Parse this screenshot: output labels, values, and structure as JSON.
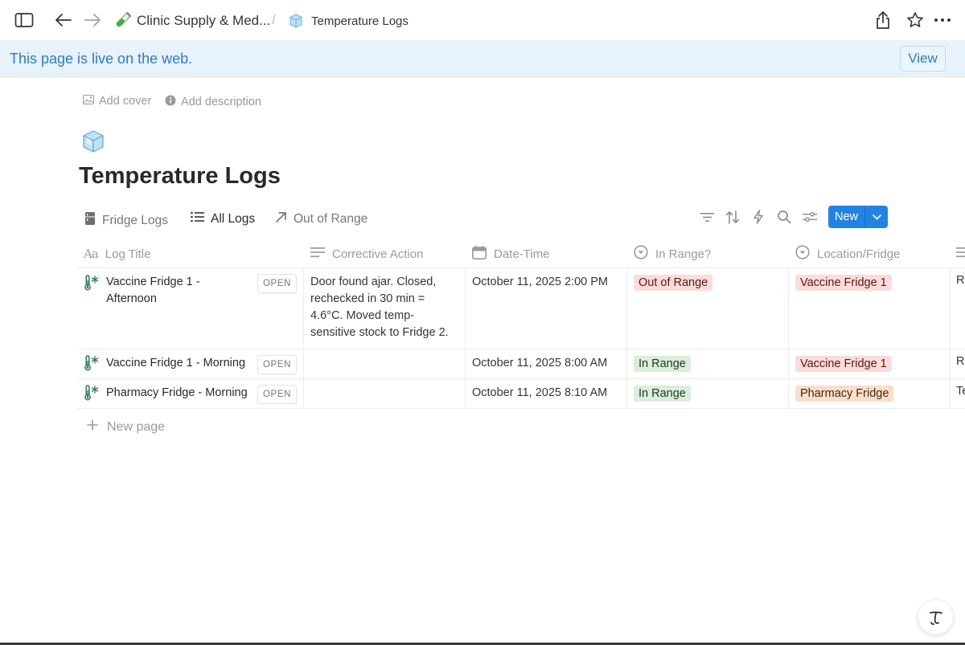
{
  "topbar": {
    "breadcrumb_workspace": "Clinic Supply & Med...",
    "breadcrumb_page": "Temperature Logs"
  },
  "banner": {
    "text": "This page is live on the web.",
    "view_label": "View"
  },
  "meta": {
    "add_cover": "Add cover",
    "add_description": "Add description"
  },
  "page": {
    "title": "Temperature Logs"
  },
  "views": [
    {
      "label": "Fridge Logs",
      "icon": "fridge-icon"
    },
    {
      "label": "All Logs",
      "icon": "list-icon",
      "active": true
    },
    {
      "label": "Out of Range",
      "icon": "arrow-up-right-icon"
    }
  ],
  "toolbar": {
    "new_label": "New"
  },
  "table": {
    "columns": [
      {
        "label": "Log Title",
        "icon": "text-type-icon"
      },
      {
        "label": "Corrective Action",
        "icon": "text-lines-icon"
      },
      {
        "label": "Date-Time",
        "icon": "calendar-icon"
      },
      {
        "label": "In Range?",
        "icon": "select-icon"
      },
      {
        "label": "Location/Fridge",
        "icon": "select-icon"
      }
    ],
    "open_label": "OPEN",
    "rows": [
      {
        "title_line1": "Vaccine Fridge 1 -",
        "title_line2": "Afternoon",
        "action_lines": [
          "Door found ajar. Closed,",
          "rechecked in 30 min =",
          "4.6°C. Moved temp-",
          "sensitive stock to Fridge 2."
        ],
        "datetime": "October 11, 2025 2:00 PM",
        "in_range": "Out of Range",
        "location": "Vaccine Fridge 1",
        "next_col": "R"
      },
      {
        "title": "Vaccine Fridge 1 - Morning",
        "datetime": "October 11, 2025 8:00 AM",
        "in_range": "In Range",
        "location": "Vaccine Fridge 1",
        "next_col": "R"
      },
      {
        "title": "Pharmacy Fridge - Morning",
        "datetime": "October 11, 2025 8:10 AM",
        "in_range": "In Range",
        "location": "Pharmacy Fridge",
        "next_col": "Te"
      }
    ],
    "new_page_label": "New page"
  },
  "colors": {
    "accent": "#2383e2",
    "banner_bg": "#e7f2fa",
    "banner_text": "#2f7cc0",
    "tag_red": "#fbdcda",
    "tag_green": "#dbeddb",
    "tag_orange": "#fadec9"
  }
}
